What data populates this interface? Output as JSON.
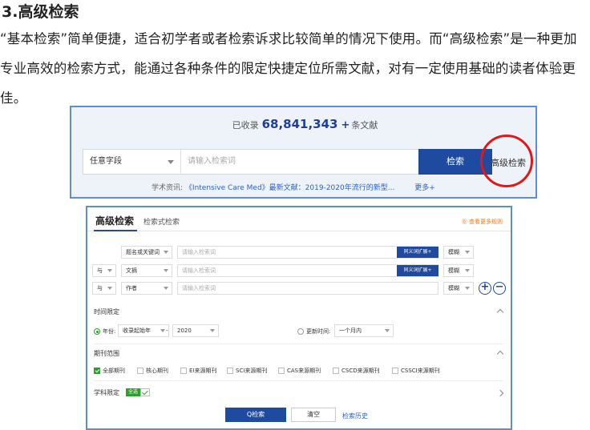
{
  "heading": "3.高级检索",
  "paragraph": "“基本检索”简单便捷，适合初学者或者检索诉求比较简单的情况下使用。而“高级检索”是一种更加专业高效的检索方式，能通过各种条件的限定快捷定位所需文献，对有一定使用基础的读者体验更佳。",
  "basic": {
    "count_prefix": "已收录",
    "count": "68,841,343",
    "count_plus": "+",
    "count_suffix": "条文献",
    "field": "任意字段",
    "placeholder": "请输入检索词",
    "search_button": "检索",
    "advanced_link": "高级检索",
    "news_prefix": "学术资讯:",
    "news_title": "《Intensive Care Med》最新文献：2019-2020年流行的新型...",
    "more": "更多+"
  },
  "advanced": {
    "tab_active": "高级检索",
    "tab_other": "检索式检索",
    "rules_link": "⓪ 查看更多规则",
    "rows": [
      {
        "logic": "",
        "field": "题名或关键词",
        "placeholder": "请输入检索词",
        "synonym": "同义词扩展+",
        "match": "模糊"
      },
      {
        "logic": "与",
        "field": "文摘",
        "placeholder": "请输入检索词",
        "synonym": "同义词扩展+",
        "match": "模糊"
      },
      {
        "logic": "与",
        "field": "作者",
        "placeholder": "请输入检索词",
        "synonym": "",
        "match": "模糊"
      }
    ],
    "add_icon": "+",
    "remove_icon": "−",
    "time_section": "时间限定",
    "year_label": "年份:",
    "year_from": "收录起始年",
    "year_dash": "-",
    "year_to": "2020",
    "update_label": "更新时间:",
    "update_value": "一个月内",
    "journal_section": "期刊范围",
    "journals": [
      {
        "label": "全部期刊",
        "checked": true
      },
      {
        "label": "核心期刊",
        "checked": false
      },
      {
        "label": "EI来源期刊",
        "checked": false
      },
      {
        "label": "SCI来源期刊",
        "checked": false
      },
      {
        "label": "CAS来源期刊",
        "checked": false
      },
      {
        "label": "CSCD来源期刊",
        "checked": false
      },
      {
        "label": "CSSCI来源期刊",
        "checked": false
      }
    ],
    "subject_label": "学科限定",
    "subject_badge": "全选",
    "search_button": "Q检索",
    "clear_button": "清空",
    "history_link": "检索历史"
  }
}
